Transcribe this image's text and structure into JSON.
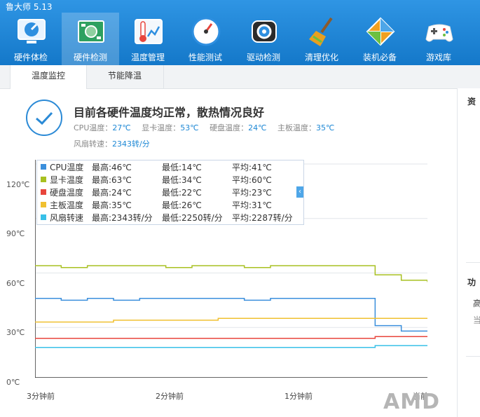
{
  "app": {
    "title": "鲁大师 5.13"
  },
  "nav": [
    {
      "label": "硬件体检",
      "icon": "monitor-icon"
    },
    {
      "label": "硬件检测",
      "icon": "circuit-board-icon",
      "active": true
    },
    {
      "label": "温度管理",
      "icon": "thermometer-icon"
    },
    {
      "label": "性能测试",
      "icon": "gauge-icon"
    },
    {
      "label": "驱动检测",
      "icon": "gear-chip-icon"
    },
    {
      "label": "清理优化",
      "icon": "broom-icon"
    },
    {
      "label": "装机必备",
      "icon": "box-icon"
    },
    {
      "label": "游戏库",
      "icon": "gamepad-icon"
    }
  ],
  "subtabs": [
    {
      "label": "温度监控",
      "active": true
    },
    {
      "label": "节能降温"
    }
  ],
  "status": {
    "title": "目前各硬件温度均正常，散热情况良好",
    "cpu_label": "CPU温度：",
    "cpu_value": "27℃",
    "gpu_label": "显卡温度：",
    "gpu_value": "53℃",
    "disk_label": "硬盘温度：",
    "disk_value": "24℃",
    "board_label": "主板温度：",
    "board_value": "35℃",
    "fan_label": "风扇转速：",
    "fan_value": "2343转/分"
  },
  "right_panel": {
    "section1": "资",
    "section2": "功",
    "item1": "高",
    "item2": "当"
  },
  "legend": [
    {
      "name": "CPU温度",
      "max": "最高:46℃",
      "min": "最低:14℃",
      "avg": "平均:41℃",
      "color": "#3b8fdc"
    },
    {
      "name": "显卡温度",
      "max": "最高:63℃",
      "min": "最低:34℃",
      "avg": "平均:60℃",
      "color": "#a8c020"
    },
    {
      "name": "硬盘温度",
      "max": "最高:24℃",
      "min": "最低:22℃",
      "avg": "平均:23℃",
      "color": "#e8453c"
    },
    {
      "name": "主板温度",
      "max": "最高:35℃",
      "min": "最低:26℃",
      "avg": "平均:31℃",
      "color": "#f0c030"
    },
    {
      "name": "风扇转速",
      "max": "最高:2343转/分",
      "min": "最低:2250转/分",
      "avg": "平均:2287转/分",
      "color": "#38c0e8"
    }
  ],
  "logo_text": "AMD",
  "chart_data": {
    "type": "line",
    "x": [
      0,
      0.2,
      0.4,
      0.6,
      0.8,
      1.0,
      1.2,
      1.4,
      1.6,
      1.8,
      2.0,
      2.2,
      2.4,
      2.6,
      2.8,
      3.0
    ],
    "x_tick_labels": [
      "3分钟前",
      "2分钟前",
      "1分钟前",
      "当前"
    ],
    "y_tick_labels": [
      "0℃",
      "30℃",
      "60℃",
      "90℃",
      "120℃"
    ],
    "ylim": [
      0,
      120
    ],
    "grid": true,
    "series": [
      {
        "name": "CPU温度",
        "color": "#3b8fdc",
        "values": [
          46,
          45,
          46,
          45,
          46,
          46,
          46,
          46,
          45,
          46,
          46,
          46,
          46,
          31,
          28,
          28
        ]
      },
      {
        "name": "显卡温度",
        "color": "#a8c020",
        "values": [
          64,
          63,
          64,
          64,
          64,
          63,
          64,
          64,
          63,
          64,
          64,
          64,
          64,
          59,
          56,
          55
        ]
      },
      {
        "name": "硬盘温度",
        "color": "#e8453c",
        "values": [
          24,
          24,
          24,
          24,
          24,
          24,
          24,
          24,
          24,
          24,
          24,
          24,
          24,
          25,
          25,
          25
        ]
      },
      {
        "name": "主板温度",
        "color": "#f0c030",
        "values": [
          33,
          33,
          33,
          34,
          34,
          34,
          34,
          35,
          35,
          35,
          35,
          35,
          35,
          35,
          35,
          35
        ]
      },
      {
        "name": "风扇转速",
        "color": "#38c0e8",
        "values": [
          19,
          19,
          19,
          19,
          19,
          19,
          19,
          19,
          19,
          19,
          19,
          19,
          19,
          20,
          20,
          20
        ]
      }
    ]
  }
}
